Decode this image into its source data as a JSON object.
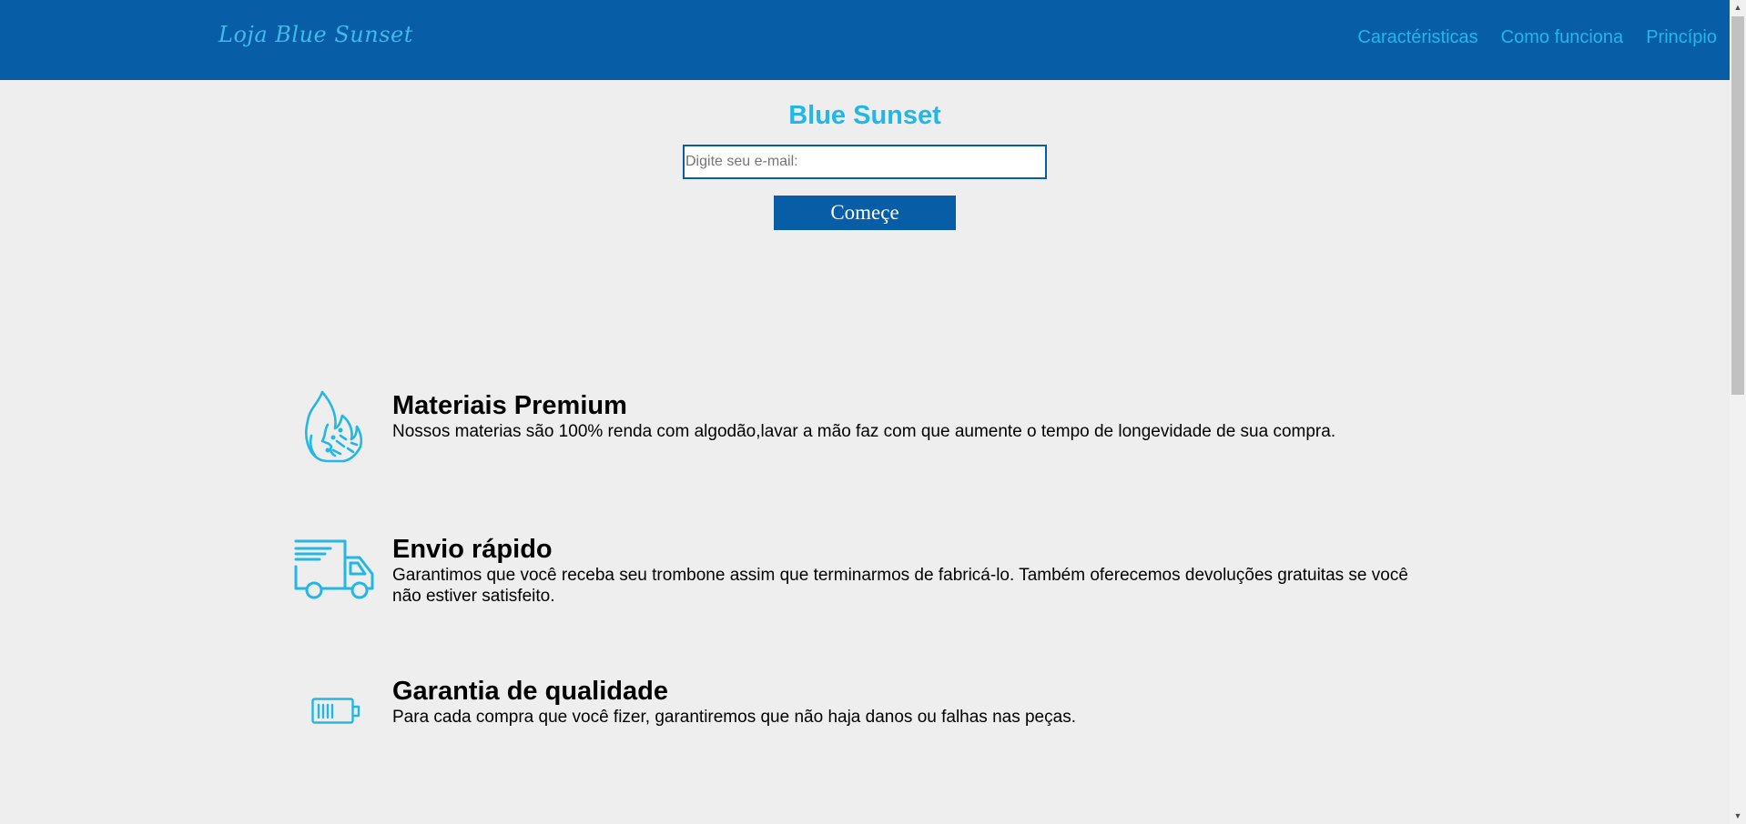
{
  "header": {
    "logo": "Loja Blue Sunset",
    "nav": [
      "Caractéristicas",
      "Como funciona",
      "Princípio"
    ]
  },
  "hero": {
    "title": "Blue Sunset",
    "email_placeholder": "Digite seu e-mail:",
    "email_value": "",
    "button_label": "Começe"
  },
  "features": [
    {
      "icon": "fire-icon",
      "title": "Materiais Premium",
      "description": "Nossos materias são 100% renda com algodão,lavar a mão faz com que aumente o tempo de longevidade de sua compra."
    },
    {
      "icon": "truck-icon",
      "title": "Envio rápido",
      "description": "Garantimos que você receba seu trombone assim que terminarmos de fabricá-lo. Também oferecemos devoluções gratuitas se você não estiver satisfeito."
    },
    {
      "icon": "battery-icon",
      "title": "Garantia de qualidade",
      "description": "Para cada compra que você fizer, garantiremos que não haja danos ou falhas nas peças."
    }
  ],
  "colors": {
    "header_bg": "#075ea6",
    "accent": "#22b7e6",
    "page_bg": "#eeeeee"
  }
}
